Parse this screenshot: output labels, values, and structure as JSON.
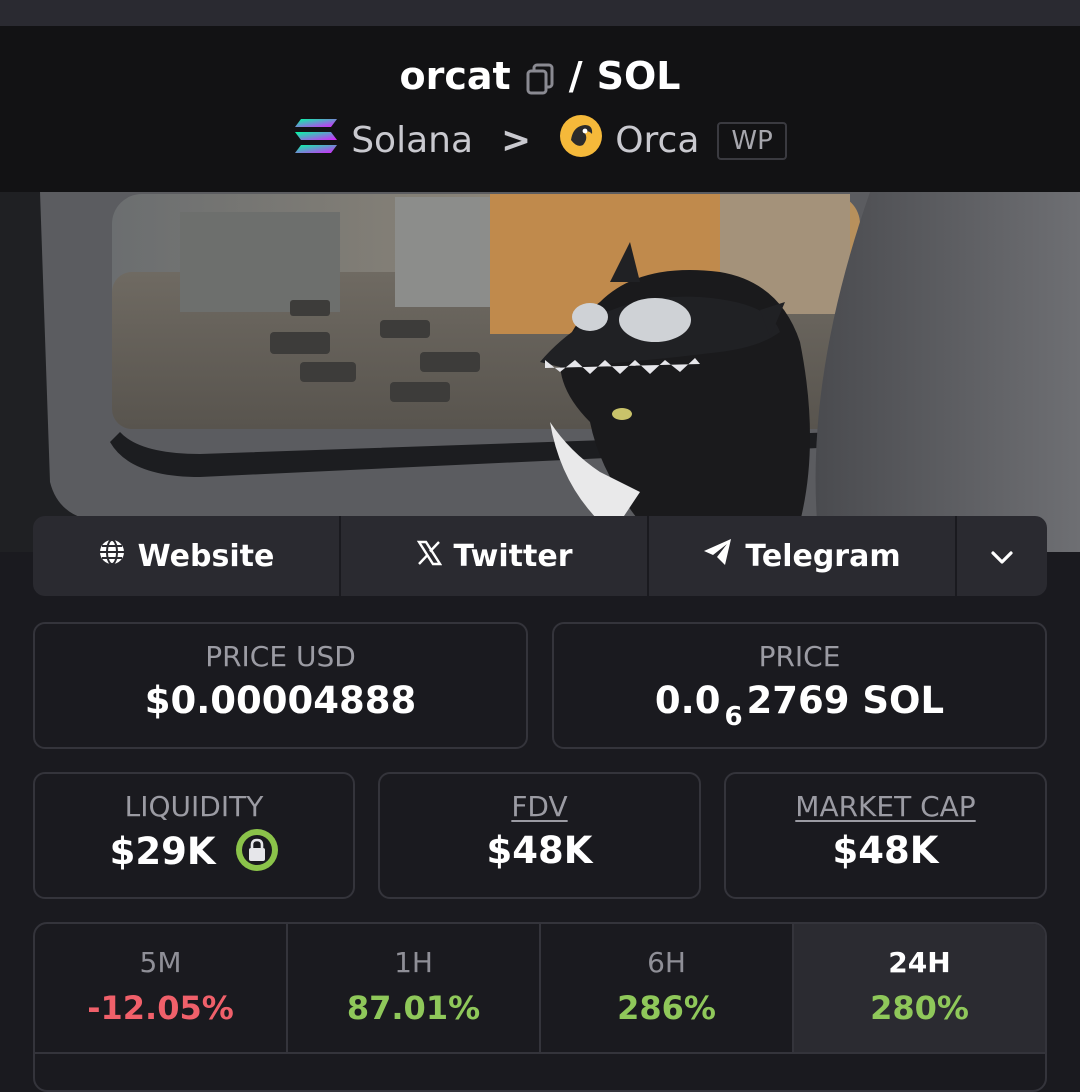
{
  "header": {
    "token": "orcat",
    "separator": "/",
    "quote": "SOL",
    "chain": "Solana",
    "chevron": ">",
    "dex": "Orca",
    "badge": "WP"
  },
  "links": {
    "website": "Website",
    "twitter": "Twitter",
    "telegram": "Telegram"
  },
  "stats": {
    "price_usd_label": "PRICE USD",
    "price_usd": "$0.00004888",
    "price_label": "PRICE",
    "price_prefix": "0.0",
    "price_zeros": "6",
    "price_rest": "2769 SOL",
    "liquidity_label": "LIQUIDITY",
    "liquidity": "$29K",
    "fdv_label": "FDV",
    "fdv": "$48K",
    "mcap_label": "MARKET CAP",
    "mcap": "$48K"
  },
  "timeframes": [
    {
      "label": "5M",
      "change": "-12.05%"
    },
    {
      "label": "1H",
      "change": "87.01%"
    },
    {
      "label": "6H",
      "change": "286%"
    },
    {
      "label": "24H",
      "change": "280%"
    }
  ],
  "icons": {
    "copy": "copy-icon",
    "solana": "solana-logo-icon",
    "orca": "orca-logo-icon",
    "globe": "globe-icon",
    "x": "x-logo-icon",
    "telegram": "telegram-icon",
    "more": "chevron-down-icon",
    "lock": "lock-icon"
  },
  "colors": {
    "negative": "#f0606a",
    "positive": "#8fc85a",
    "lock_ring": "#8bc34a"
  }
}
